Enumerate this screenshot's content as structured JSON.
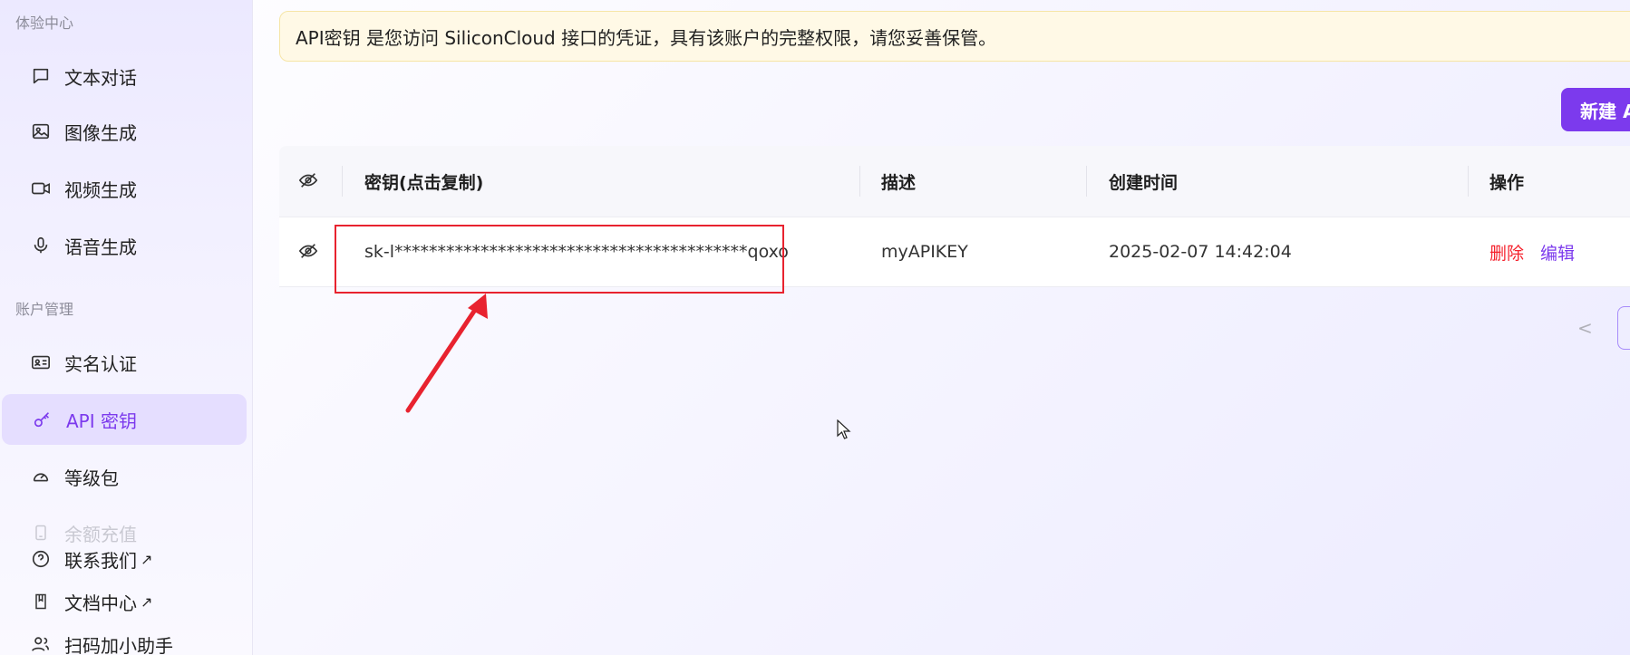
{
  "sidebar": {
    "section_experience": "体验中心",
    "section_account": "账户管理",
    "items": [
      {
        "label": "文本对话",
        "icon": "chat-bubble-icon"
      },
      {
        "label": "图像生成",
        "icon": "image-icon"
      },
      {
        "label": "视频生成",
        "icon": "video-camera-icon"
      },
      {
        "label": "语音生成",
        "icon": "microphone-icon"
      },
      {
        "label": "实名认证",
        "icon": "id-card-icon"
      },
      {
        "label": "API 密钥",
        "icon": "key-icon"
      },
      {
        "label": "等级包",
        "icon": "gauge-icon"
      },
      {
        "label": "余额充值",
        "icon": "wallet-icon"
      },
      {
        "label": "联系我们",
        "icon": "help-circle-icon",
        "ext": "↗"
      },
      {
        "label": "文档中心",
        "icon": "book-icon",
        "ext": "↗"
      },
      {
        "label": "扫码加小助手",
        "icon": "users-icon"
      }
    ]
  },
  "notice": {
    "text": "API密钥 是您访问 SiliconCloud 接口的凭证，具有该账户的完整权限，请您妥善保管。"
  },
  "toolbar": {
    "new_button_label": "新建 A"
  },
  "table": {
    "headers": {
      "key": "密钥(点击复制)",
      "description": "描述",
      "created": "创建时间",
      "actions": "操作"
    },
    "rows": [
      {
        "key": "sk-l*****************************************qoxo",
        "description": "myAPIKEY",
        "created": "2025-02-07 14:42:04",
        "delete_label": "删除",
        "edit_label": "编辑"
      }
    ]
  },
  "pagination": {
    "prev_symbol": "<"
  },
  "colors": {
    "accent": "#7c3aed",
    "danger": "#f5222d",
    "notice_bg": "#fff9e6",
    "annotation": "#e8232f"
  }
}
